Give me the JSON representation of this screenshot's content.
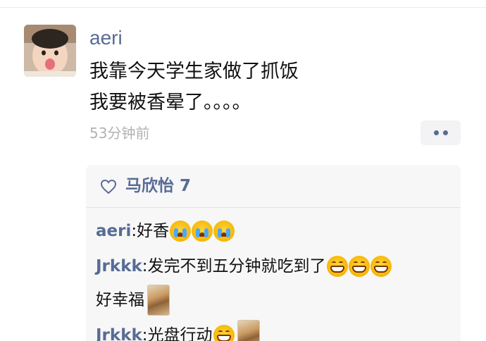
{
  "post": {
    "author": "aeri",
    "lines": [
      "我靠今天学生家做了抓饭",
      "我要被香晕了。。。。"
    ],
    "time": "53分钟前"
  },
  "likes": {
    "names": "马欣怡 7"
  },
  "comments": [
    {
      "author": "aeri",
      "separator": ": ",
      "text": "好香",
      "emoji": "crying-face-icon"
    },
    {
      "author": "Jrkkk",
      "separator": ": ",
      "text": "发完不到五分钟就吃到了",
      "text2": "好幸福",
      "emoji": "grinning-face-icon"
    },
    {
      "author": "Jrkkk",
      "separator": ": ",
      "text": "光盘行动",
      "emoji": "grinning-face-icon"
    }
  ],
  "colors": {
    "link": "#576b95",
    "text": "#111111",
    "timestamp": "#b2b2b2",
    "comment_bg": "#f7f7f7"
  }
}
